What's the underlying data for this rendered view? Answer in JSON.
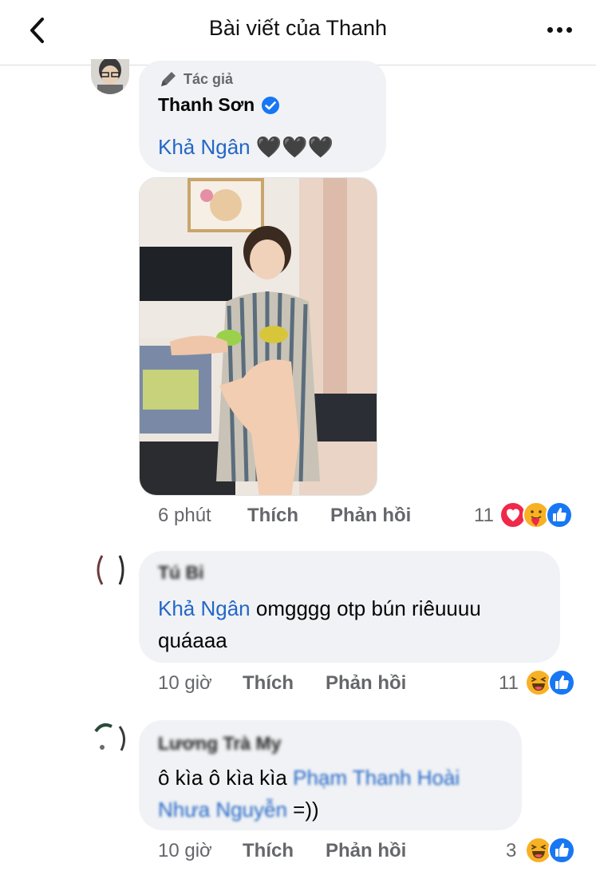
{
  "header": {
    "title": "Bài viết của Thanh"
  },
  "comments": [
    {
      "author_badge": "Tác giả",
      "author": "Thanh Sơn",
      "mention": "Khả Ngân",
      "text": "🖤🖤🖤",
      "time": "6 phút",
      "like_label": "Thích",
      "reply_label": "Phản hồi",
      "reaction_count": "11",
      "reactions": [
        "love",
        "care",
        "like"
      ]
    },
    {
      "author": "Tú Bi",
      "mention": "Khả Ngân",
      "text_line1": "omgggg otp bún riêuuuu",
      "text_line2": "quáaaa",
      "time": "10 giờ",
      "like_label": "Thích",
      "reply_label": "Phản hồi",
      "reaction_count": "11",
      "reactions": [
        "haha",
        "like"
      ]
    },
    {
      "author": "Lương Trà My",
      "text": "ô kìa ô kìa kìa",
      "mention_line1": "Phạm Thanh Hoài",
      "mention_line2": "Nhưa Nguyễn",
      "suffix": " =))",
      "time": "10 giờ",
      "like_label": "Thích",
      "reply_label": "Phản hồi",
      "reaction_count": "3",
      "reactions": [
        "haha",
        "like"
      ]
    }
  ],
  "colors": {
    "mention": "#2467c6",
    "bubble": "#f0f2f5",
    "meta": "#65676b",
    "like": "#1877f2",
    "love": "#f02849",
    "haha": "#f7b125"
  }
}
